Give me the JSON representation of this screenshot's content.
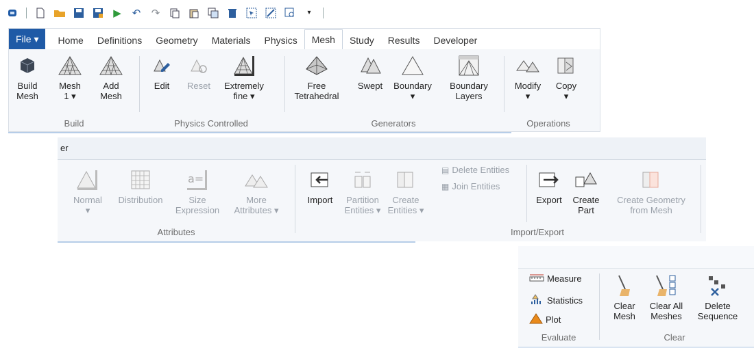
{
  "quick_access": {
    "icons": [
      "app-icon",
      "new-icon",
      "open-icon",
      "save-icon",
      "save-as-icon",
      "run-icon",
      "undo-icon",
      "redo-icon",
      "copy-icon",
      "paste-icon",
      "duplicate-icon",
      "delete-icon",
      "select-icon",
      "clear-select-icon",
      "zoom-icon"
    ]
  },
  "tabs": {
    "file": "File ▾",
    "items": [
      "Home",
      "Definitions",
      "Geometry",
      "Materials",
      "Physics",
      "Mesh",
      "Study",
      "Results",
      "Developer"
    ]
  },
  "mesh_ribbon": {
    "build": {
      "label": "Build",
      "build_mesh": "Build\nMesh",
      "mesh1": "Mesh\n1 ▾",
      "add_mesh": "Add\nMesh"
    },
    "physics": {
      "label": "Physics Controlled",
      "edit": "Edit",
      "reset": "Reset",
      "fine": "Extremely\nfine ▾"
    },
    "generators": {
      "label": "Generators",
      "free_tet": "Free\nTetrahedral",
      "swept": "Swept",
      "boundary": "Boundary\n▾",
      "boundary_layers": "Boundary\nLayers"
    },
    "operations": {
      "label": "Operations",
      "modify": "Modify\n▾",
      "copy": "Copy\n▾"
    }
  },
  "panel2": {
    "header": "er",
    "attributes": {
      "label": "Attributes",
      "normal": "Normal\n▾",
      "distribution": "Distribution",
      "size_expr": "Size\nExpression",
      "more_attr": "More\nAttributes ▾"
    },
    "import_export": {
      "label": "Import/Export",
      "import": "Import",
      "partition": "Partition\nEntities ▾",
      "create_entities": "Create\nEntities ▾",
      "delete_entities": "Delete Entities",
      "join_entities": "Join Entities",
      "export": "Export",
      "create_part": "Create\nPart",
      "create_geom": "Create Geometry\nfrom Mesh"
    }
  },
  "panel3": {
    "evaluate": {
      "label": "Evaluate",
      "measure": "Measure",
      "statistics": "Statistics",
      "plot": "Plot"
    },
    "clear": {
      "label": "Clear",
      "clear_mesh": "Clear\nMesh",
      "clear_all": "Clear All\nMeshes",
      "delete_seq": "Delete\nSequence"
    }
  },
  "colors": {
    "file_tab": "#1f5aa6",
    "ribbon_bg": "#f5f7fa",
    "accent_orange": "#e98a1b",
    "mesh_gray": "#7a7a7a"
  }
}
